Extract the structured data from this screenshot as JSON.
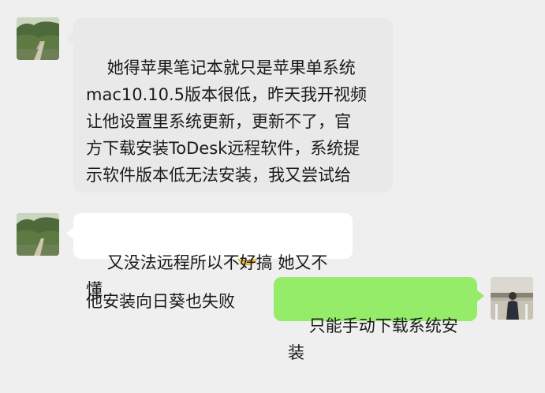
{
  "messages": [
    {
      "sender": "contact",
      "text": "她得苹果笔记本就只是苹果单系统\nmac10.10.5版本很低，昨天我开视频\n让他设置里系统更新，更新不了，官\n方下载安装ToDesk远程软件，系统提\n示软件版本低无法安装，我又尝试给\n他安装向日葵也失败",
      "emoji": "grimace-emoji"
    },
    {
      "sender": "contact",
      "text": "又没法远程所以不好搞 她又不懂"
    },
    {
      "sender": "me",
      "text": "只能手动下载系统安装"
    }
  ],
  "colors": {
    "background": "#efefef",
    "received_bubble": "#ffffff",
    "sent_bubble": "#95ec69"
  }
}
